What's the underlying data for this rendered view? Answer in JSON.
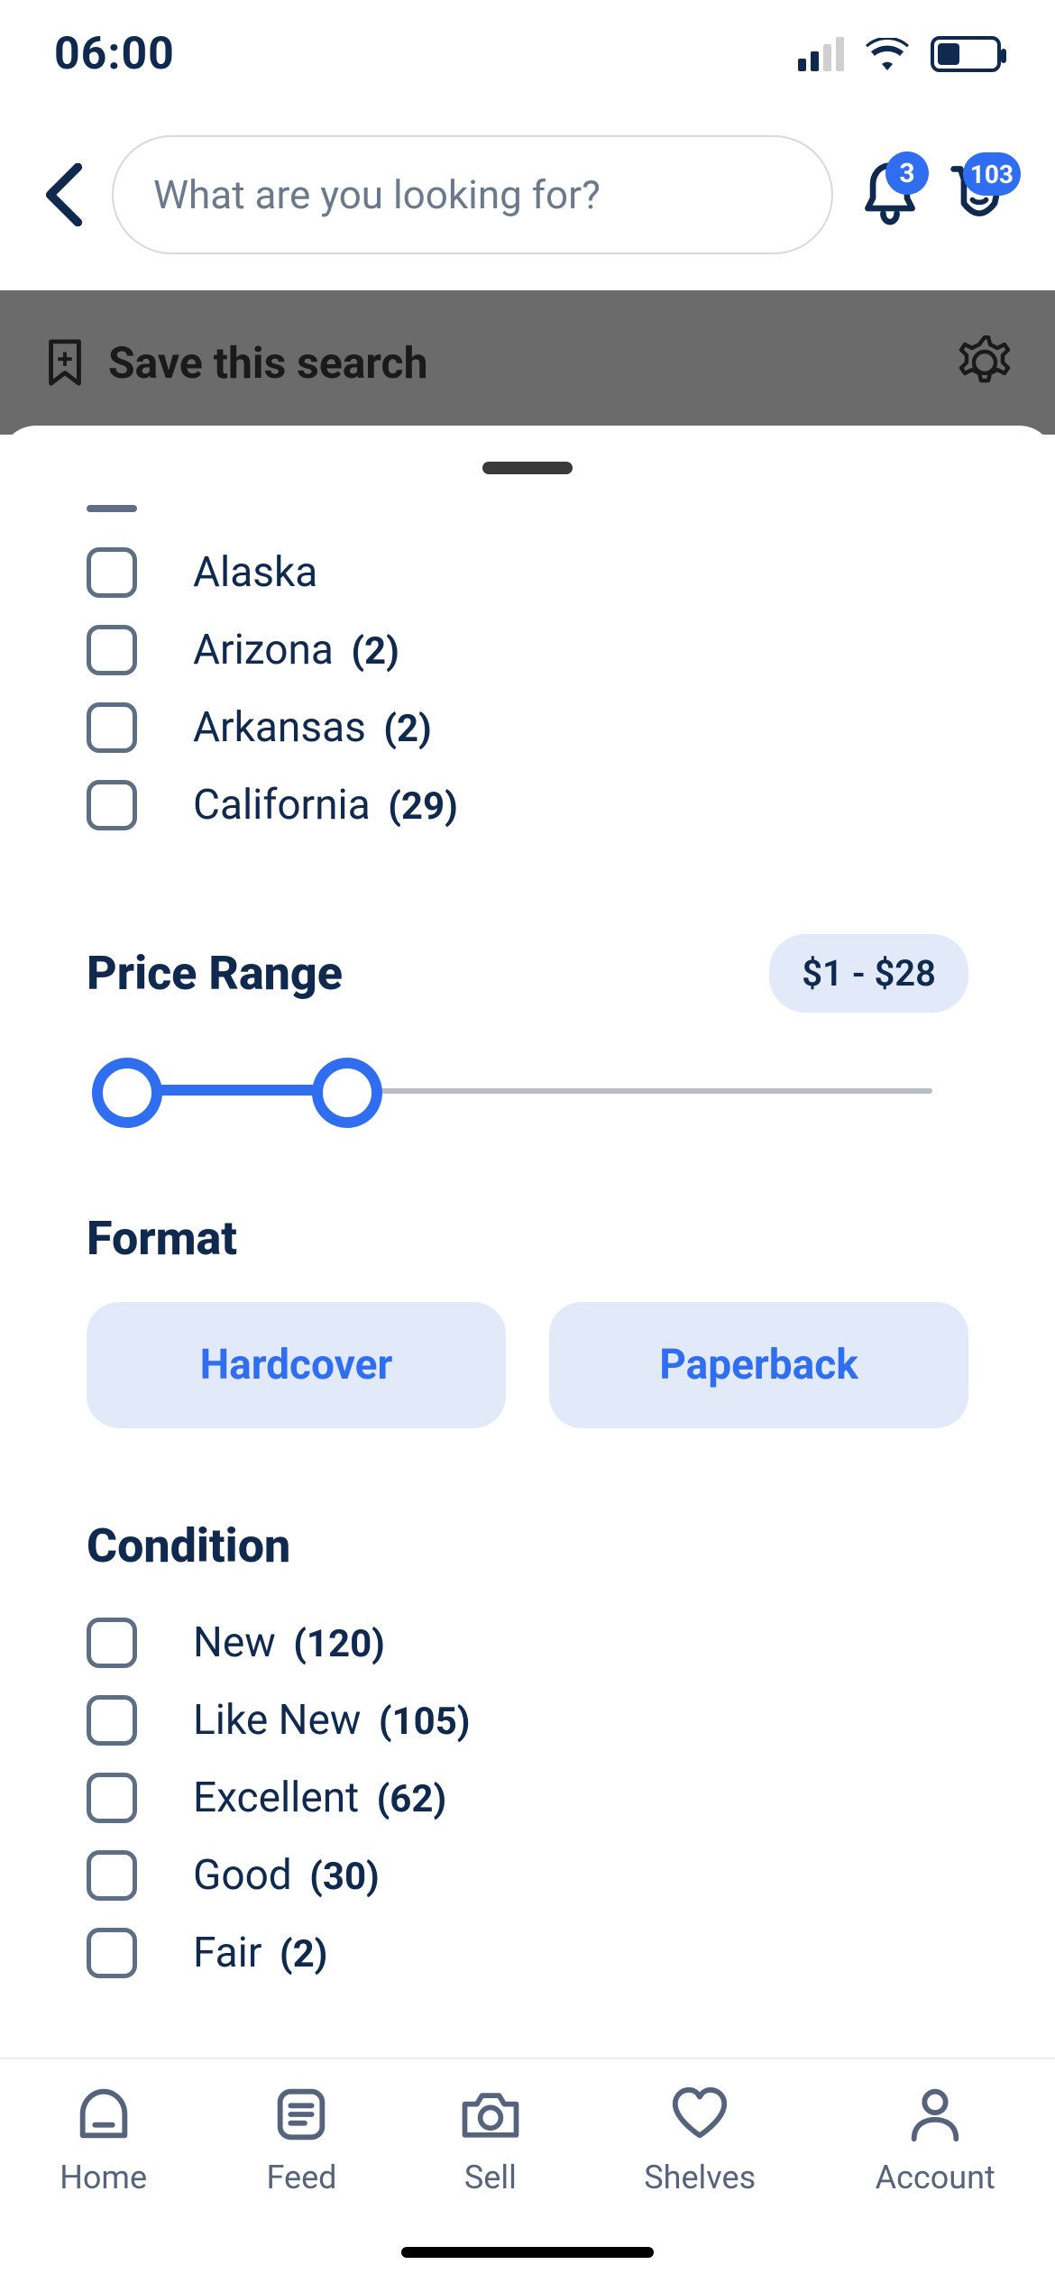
{
  "status": {
    "time": "06:00"
  },
  "header": {
    "search_placeholder": "What are you looking for?",
    "notification_count": "3",
    "cart_count": "103"
  },
  "save_bar": {
    "label": "Save this search"
  },
  "location_filter": {
    "options": [
      {
        "label": "Alaska",
        "count": null
      },
      {
        "label": "Arizona",
        "count": "(2)"
      },
      {
        "label": "Arkansas",
        "count": "(2)"
      },
      {
        "label": "California",
        "count": "(29)"
      }
    ]
  },
  "price_range": {
    "title": "Price Range",
    "label": "$1 - $28"
  },
  "format": {
    "title": "Format",
    "options": [
      "Hardcover",
      "Paperback"
    ]
  },
  "condition": {
    "title": "Condition",
    "options": [
      {
        "label": "New",
        "count": "(120)"
      },
      {
        "label": "Like New",
        "count": "(105)"
      },
      {
        "label": "Excellent",
        "count": "(62)"
      },
      {
        "label": "Good",
        "count": "(30)"
      },
      {
        "label": "Fair",
        "count": "(2)"
      }
    ]
  },
  "nav": {
    "home": "Home",
    "feed": "Feed",
    "sell": "Sell",
    "shelves": "Shelves",
    "account": "Account"
  }
}
